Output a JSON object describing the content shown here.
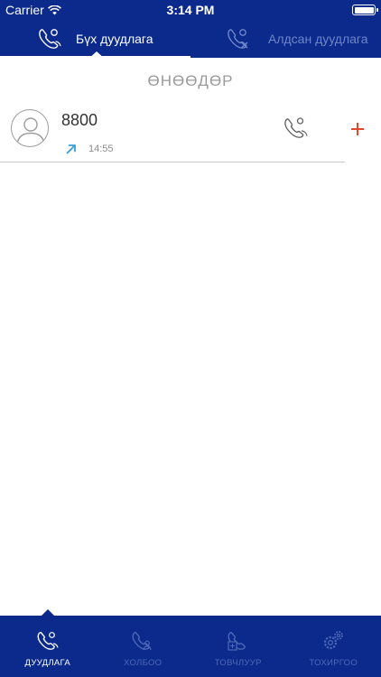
{
  "status_bar": {
    "carrier": "Carrier",
    "time": "3:14 PM"
  },
  "top_tabs": [
    {
      "label": "Бүх дуудлага",
      "icon": "phone-outgoing-icon",
      "active": true
    },
    {
      "label": "Алдсан дуудлага",
      "icon": "phone-missed-icon",
      "active": false
    }
  ],
  "section": {
    "title": "ӨНӨӨДӨР"
  },
  "calls": [
    {
      "number": "8800",
      "time": "14:55",
      "direction_icon": "outgoing-arrow-icon",
      "avatar_icon": "person-icon",
      "action_icon": "phone-icon",
      "add_icon": "plus-icon"
    }
  ],
  "bottom_tabs": [
    {
      "label": "ДУУДЛАГА",
      "icon": "phone-icon",
      "active": true
    },
    {
      "label": "ХОЛБОО",
      "icon": "phone-book-icon",
      "active": false
    },
    {
      "label": "ТОВЧЛУУР",
      "icon": "dialpad-icon",
      "active": false
    },
    {
      "label": "ТОХИРГОО",
      "icon": "gear-icon",
      "active": false
    }
  ],
  "colors": {
    "brand_blue": "#0b2a8c",
    "inactive_blue": "#6f86c7",
    "accent_red": "#e8462a",
    "direction_blue": "#3aa0d8"
  }
}
